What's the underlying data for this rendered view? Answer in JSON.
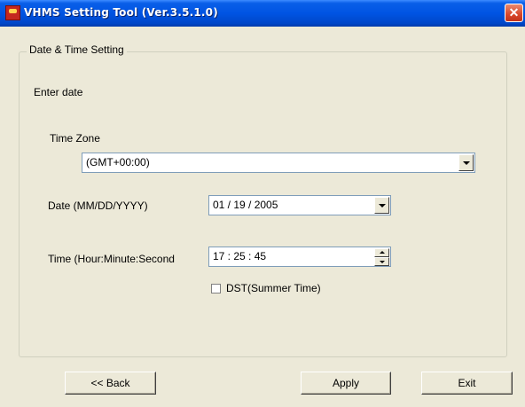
{
  "window": {
    "title": "VHMS Setting Tool  (Ver.3.5.1.0)",
    "close_glyph": "✕"
  },
  "group": {
    "legend": "Date & Time Setting"
  },
  "form": {
    "instruction": "Enter date",
    "time_zone_label": "Time Zone",
    "time_zone_value": "(GMT+00:00)",
    "date_label": "Date (MM/DD/YYYY)",
    "date_value": "01 / 19 / 2005",
    "time_label": "Time (Hour:Minute:Second",
    "time_value": "17 : 25 : 45",
    "dst_label": "DST(Summer Time)",
    "dst_checked": false
  },
  "buttons": {
    "back": "<< Back",
    "apply": "Apply",
    "exit": "Exit"
  },
  "icons": {
    "app": "vhms-app-icon",
    "close": "close-icon",
    "dropdown": "chevron-down-icon",
    "spin": "spin-arrows-icon"
  }
}
